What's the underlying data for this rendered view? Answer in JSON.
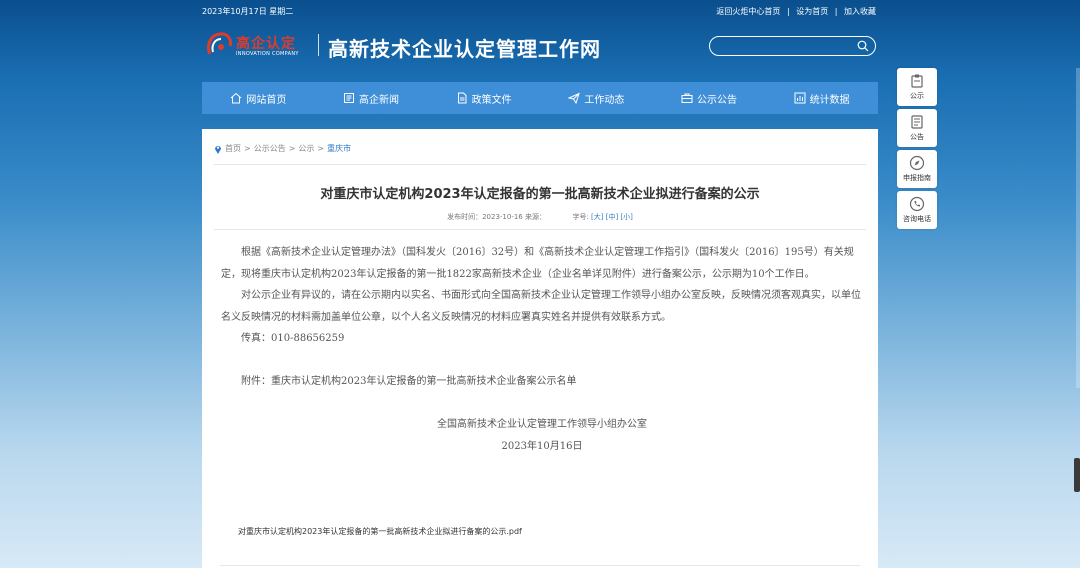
{
  "topbar": {
    "date": "2023年10月17日 星期二",
    "link_home": "返回火炬中心首页",
    "link_sethome": "设为首页",
    "link_fav": "加入收藏",
    "divider": "|"
  },
  "logo": {
    "brand": "高企认定",
    "sub": "INNOVATION COMPANY",
    "site_title": "高新技术企业认定管理工作网"
  },
  "search": {
    "value": "",
    "placeholder": ""
  },
  "nav": {
    "items": [
      {
        "label": "网站首页",
        "icon": "home-icon"
      },
      {
        "label": "高企新闻",
        "icon": "news-icon"
      },
      {
        "label": "政策文件",
        "icon": "document-icon"
      },
      {
        "label": "工作动态",
        "icon": "paper-plane-icon"
      },
      {
        "label": "公示公告",
        "icon": "briefcase-icon"
      },
      {
        "label": "统计数据",
        "icon": "chart-icon"
      }
    ]
  },
  "breadcrumb": {
    "home": "首页",
    "sep": ">",
    "level1": "公示公告",
    "level2": "公示",
    "current": "重庆市"
  },
  "article": {
    "title": "对重庆市认定机构2023年认定报备的第一批高新技术企业拟进行备案的公示",
    "meta_date": "发布时间：2023-10-16 来源：",
    "font_label": "字号:",
    "font_large": "[大]",
    "font_medium": "[中]",
    "font_small": "[小]",
    "para1": "根据《高新技术企业认定管理办法》（国科发火〔2016〕32号）和《高新技术企业认定管理工作指引》（国科发火〔2016〕195号）有关规定，现将重庆市认定机构2023年认定报备的第一批1822家高新技术企业（企业名单详见附件）进行备案公示，公示期为10个工作日。",
    "para2": "对公示企业有异议的，请在公示期内以实名、书面形式向全国高新技术企业认定管理工作领导小组办公室反映，反映情况须客观真实，以单位名义反映情况的材料需加盖单位公章，以个人名义反映情况的材料应署真实姓名并提供有效联系方式。",
    "fax": "传真：010-88656259",
    "attachment": "附件：重庆市认定机构2023年认定报备的第一批高新技术企业备案公示名单",
    "signature": "全国高新技术企业认定管理工作领导小组办公室",
    "sign_date": "2023年10月16日",
    "file_link": "对重庆市认定机构2023年认定报备的第一批高新技术企业拟进行备案的公示.pdf"
  },
  "side": {
    "items": [
      {
        "label": "公示",
        "icon": "clipboard-icon"
      },
      {
        "label": "公告",
        "icon": "notice-icon"
      },
      {
        "label": "申报指南",
        "icon": "compass-icon"
      },
      {
        "label": "咨询电话",
        "icon": "phone-icon"
      }
    ]
  },
  "colors": {
    "nav_bg": "#3f8fd8",
    "accent": "#2f7cc7",
    "brand_red": "#e03c2c"
  }
}
